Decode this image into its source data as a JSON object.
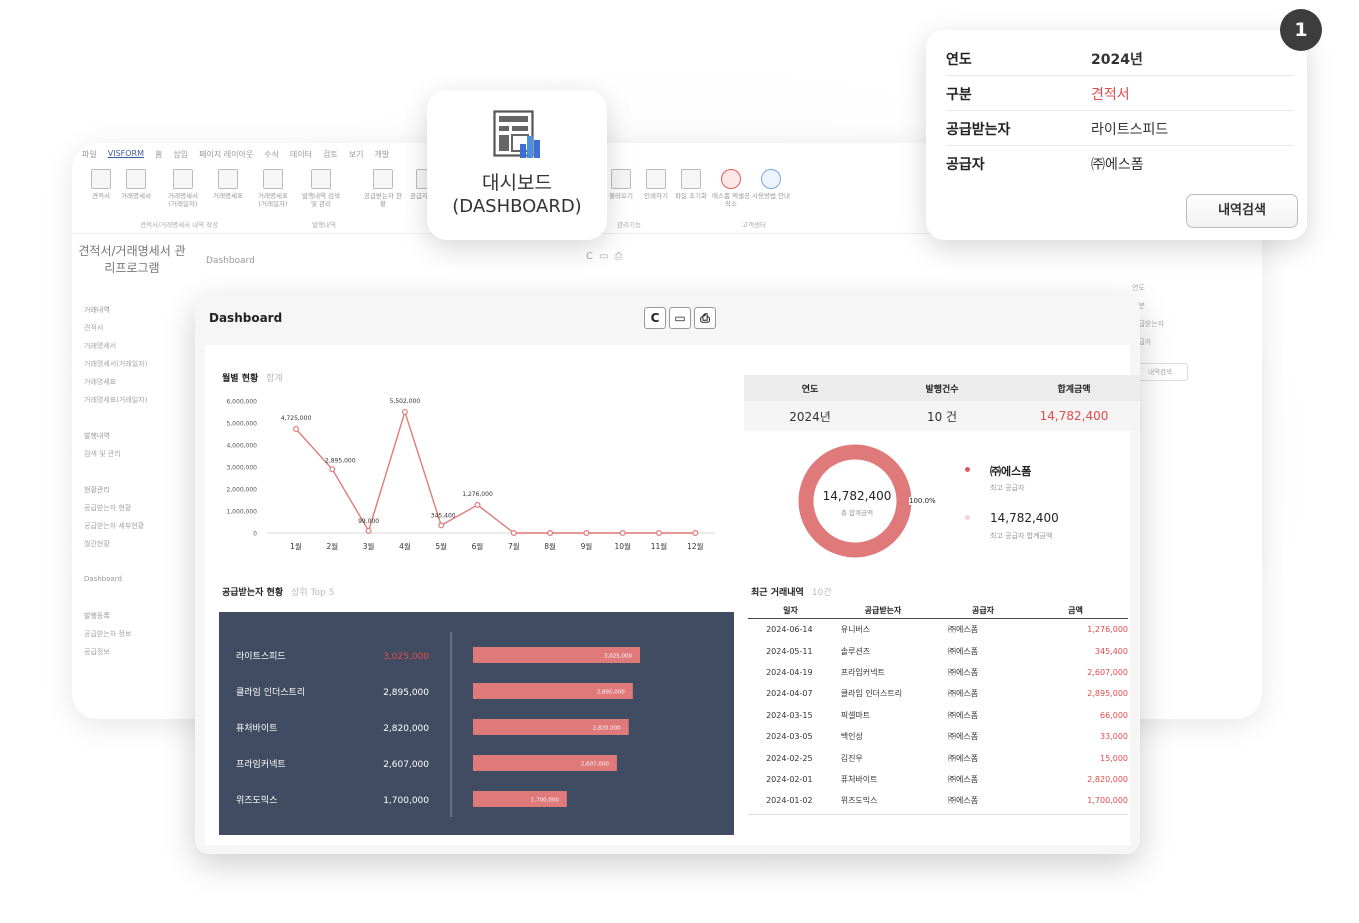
{
  "back": {
    "tabs": [
      "파일",
      "VISFORM",
      "홈",
      "삽입",
      "페이지 레이아웃",
      "수식",
      "데이터",
      "검토",
      "보기",
      "개발"
    ],
    "active_tab": 1,
    "ribbon_buttons": [
      {
        "label": "견적서",
        "icon": "document"
      },
      {
        "label": "거래명세서",
        "icon": "document"
      },
      {
        "label": "거래명세서 (거래일자)",
        "icon": "document"
      },
      {
        "label": "거래명세표",
        "icon": "document"
      },
      {
        "label": "거래명세표 (거래일자)",
        "icon": "document"
      },
      {
        "label": "발행내역 검색 및 관리",
        "icon": "document"
      },
      {
        "label": "공급받는자 현황",
        "icon": "table"
      },
      {
        "label": "공급자 세부",
        "icon": "table"
      },
      {
        "label": "불러오기",
        "icon": "document"
      },
      {
        "label": "인쇄하기",
        "icon": "print"
      },
      {
        "label": "파일 초기화",
        "icon": "trash"
      },
      {
        "label": "에스폼 엑셀공작소",
        "icon": "red-circle"
      },
      {
        "label": "사용방법 안내",
        "icon": "info"
      }
    ],
    "groups": [
      "견적서/거래명세서 내역 작성",
      "발행내역",
      "관리기능",
      "고객센터"
    ],
    "app_title": "견적서/거래명세서 관리프로그램",
    "dashboard_label": "Dashboard",
    "sidebar": [
      {
        "text": "거래내역",
        "head": true
      },
      {
        "text": "견적서",
        "head": false
      },
      {
        "text": "거래명세서",
        "head": false
      },
      {
        "text": "거래명세서(거래일자)",
        "head": false
      },
      {
        "text": "거래명세표",
        "head": false
      },
      {
        "text": "거래명세표(거래일자)",
        "head": false
      },
      {
        "text": "",
        "head": false
      },
      {
        "text": "발행내역",
        "head": true
      },
      {
        "text": "검색 및 관리",
        "head": false
      },
      {
        "text": "",
        "head": false
      },
      {
        "text": "현황관리",
        "head": true
      },
      {
        "text": "공급받는자 현황",
        "head": false
      },
      {
        "text": "공급받는자 세부현황",
        "head": false
      },
      {
        "text": "월간현황",
        "head": false
      },
      {
        "text": "",
        "head": false
      },
      {
        "text": "Dashboard",
        "head": true
      },
      {
        "text": "",
        "head": false
      },
      {
        "text": "발행등록",
        "head": true
      },
      {
        "text": "공급받는자 정보",
        "head": false
      },
      {
        "text": "공급정보",
        "head": false
      }
    ],
    "right": [
      "연도",
      "구분",
      "공급받는자",
      "공급자"
    ],
    "right_button": "내역검색"
  },
  "popup": {
    "title_ko": "대시보드",
    "title_en": "(DASHBOARD)",
    "icon": "dashboard-layout-icon"
  },
  "filter": {
    "badge": "1",
    "rows": [
      {
        "label": "연도",
        "value": "2024년",
        "style": "bold"
      },
      {
        "label": "구분",
        "value": "견적서",
        "style": "red"
      },
      {
        "label": "공급받는자",
        "value": "라이트스피드",
        "style": ""
      },
      {
        "label": "공급자",
        "value": "㈜에스폼",
        "style": ""
      }
    ],
    "button": "내역검색"
  },
  "dashboard": {
    "title": "Dashboard",
    "toolbar": [
      {
        "icon": "refresh-icon",
        "glyph": "C"
      },
      {
        "icon": "laptop-icon",
        "glyph": "▭"
      },
      {
        "icon": "print-icon",
        "glyph": "⎙"
      }
    ],
    "monthly_title": "월별 현황",
    "monthly_sub": "합계",
    "supplier_title": "공급받는자 현황",
    "supplier_sub": "상위 Top 5",
    "summary": {
      "headers": [
        "연도",
        "발행건수",
        "합계금액"
      ],
      "year": "2024년",
      "count": "10 건",
      "total": "14,782,400"
    },
    "donut": {
      "center_value": "14,782,400",
      "center_label": "총 합계금액",
      "percent": "100.0%",
      "color": "#e07a7a"
    },
    "legend": [
      {
        "name": "㈜에스폼",
        "sub": "최고 공급자"
      },
      {
        "name": "14,782,400",
        "sub": "최고 공급자 합계금액"
      }
    ],
    "recent_title": "최근 거래내역",
    "recent_sub": "10건",
    "recent_headers": [
      "일자",
      "공급받는자",
      "공급자",
      "금액"
    ],
    "recent_rows": [
      [
        "2024-06-14",
        "유니버스",
        "㈜에스폼",
        "1,276,000"
      ],
      [
        "2024-05-11",
        "솔루션즈",
        "㈜에스폼",
        "345,400"
      ],
      [
        "2024-04-19",
        "프라임커넥트",
        "㈜에스폼",
        "2,607,000"
      ],
      [
        "2024-04-07",
        "클라임 인더스트리",
        "㈜에스폼",
        "2,895,000"
      ],
      [
        "2024-03-15",
        "픽셀마트",
        "㈜에스폼",
        "66,000"
      ],
      [
        "2024-03-05",
        "백인성",
        "㈜에스폼",
        "33,000"
      ],
      [
        "2024-02-25",
        "김진우",
        "㈜에스폼",
        "15,000"
      ],
      [
        "2024-02-01",
        "퓨처바이트",
        "㈜에스폼",
        "2,820,000"
      ],
      [
        "2024-01-02",
        "위즈도믹스",
        "㈜에스폼",
        "1,700,000"
      ]
    ]
  },
  "chart_data": [
    {
      "type": "line",
      "title": "월별 현황",
      "categories": [
        "1월",
        "2월",
        "3월",
        "4월",
        "5월",
        "6월",
        "7월",
        "8월",
        "9월",
        "10월",
        "11월",
        "12월"
      ],
      "values": [
        4725000,
        2895000,
        99000,
        5502000,
        345400,
        1276000,
        0,
        0,
        0,
        0,
        0,
        0
      ],
      "point_labels": [
        "4,725,000",
        "2,895,000",
        "99,000",
        "5,502,000",
        "345,400",
        "1,276,000",
        "",
        "",
        "",
        "",
        "",
        ""
      ],
      "yticks": [
        "0",
        "1,000,000",
        "2,000,000",
        "3,000,000",
        "4,000,000",
        "5,000,000",
        "6,000,000"
      ],
      "ylim": [
        0,
        6000000
      ],
      "color": "#e07a7a"
    },
    {
      "type": "bar",
      "orientation": "horizontal",
      "title": "공급받는자 현황",
      "categories": [
        "라이트스피드",
        "클라임 인더스트리",
        "퓨처바이트",
        "프라임커넥트",
        "위즈도믹스"
      ],
      "values": [
        3025000,
        2895000,
        2820000,
        2607000,
        1700000
      ],
      "value_labels": [
        "3,025,000",
        "2,895,000",
        "2,820,000",
        "2,607,000",
        "1,700,000"
      ],
      "color": "#e07a7a",
      "highlight_color": "#e24b4b"
    }
  ]
}
